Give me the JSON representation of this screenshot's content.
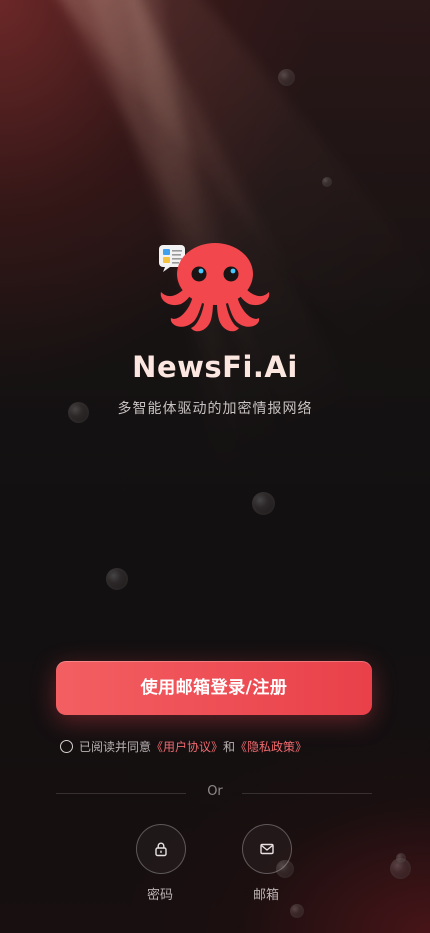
{
  "app": {
    "name": "NewsFi.Ai",
    "tagline": "多智能体驱动的加密情报网络"
  },
  "login": {
    "primary_label": "使用邮箱登录/注册",
    "agree_prefix": "已阅读并同意",
    "user_agreement": "《用户协议》",
    "and": "和",
    "privacy_policy": "《隐私政策》",
    "divider": "Or",
    "options": [
      {
        "label": "密码",
        "icon": "lock-icon"
      },
      {
        "label": "邮箱",
        "icon": "mail-icon"
      }
    ]
  },
  "colors": {
    "accent": "#ef4f56",
    "mascot": "#f2474c",
    "link": "#f06a6e"
  }
}
